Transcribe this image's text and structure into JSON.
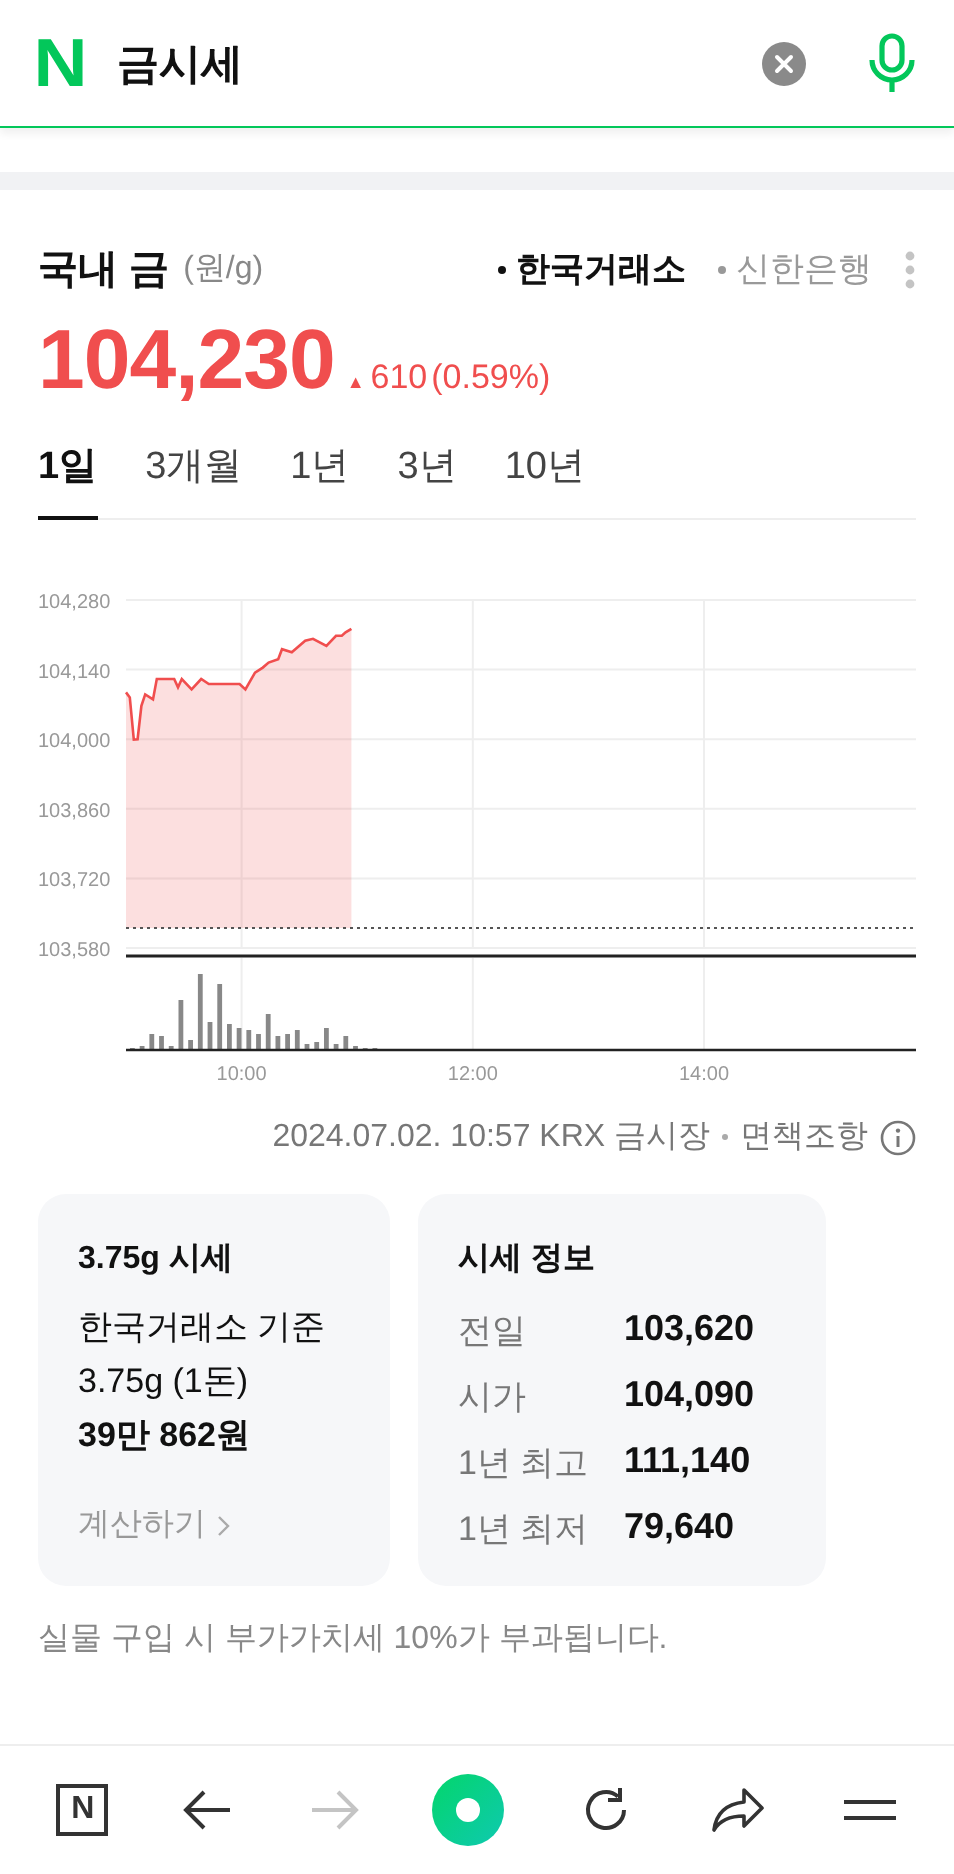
{
  "header": {
    "logo": "N",
    "query": "금시세"
  },
  "quote": {
    "title": "국내 금",
    "unit": "(원/g)",
    "sources": [
      {
        "label": "한국거래소",
        "selected": true
      },
      {
        "label": "신한은행",
        "selected": false
      }
    ],
    "price": "104,230",
    "change_arrow": "▲",
    "change": "610",
    "change_pct": "(0.59%)"
  },
  "tabs": [
    {
      "label": "1일",
      "selected": true
    },
    {
      "label": "3개월",
      "selected": false
    },
    {
      "label": "1년",
      "selected": false
    },
    {
      "label": "3년",
      "selected": false
    },
    {
      "label": "10년",
      "selected": false
    }
  ],
  "chart_data": {
    "type": "area",
    "xlim": [
      540,
      950
    ],
    "ylim": [
      103580,
      104280
    ],
    "yticks": [
      {
        "value": 104280,
        "label": "104,280"
      },
      {
        "value": 104140,
        "label": "104,140"
      },
      {
        "value": 104000,
        "label": "104,000"
      },
      {
        "value": 103860,
        "label": "103,860"
      },
      {
        "value": 103720,
        "label": "103,720"
      },
      {
        "value": 103580,
        "label": "103,580"
      }
    ],
    "xticks": [
      {
        "value": 600,
        "label": "10:00"
      },
      {
        "value": 720,
        "label": "12:00"
      },
      {
        "value": 840,
        "label": "14:00"
      }
    ],
    "x": [
      540,
      542,
      544,
      546,
      548,
      550,
      554,
      556,
      565,
      567,
      569,
      574,
      579,
      583,
      599,
      602,
      607,
      611,
      614,
      619,
      621,
      626,
      633,
      637,
      644,
      649,
      652,
      654,
      657
    ],
    "series": [
      {
        "color": "#f04e4e",
        "values": [
          104094,
          104084,
          103999,
          104000,
          104067,
          104090,
          104080,
          104121,
          104121,
          104104,
          104121,
          104100,
          104121,
          104111,
          104111,
          104100,
          104134,
          104144,
          104154,
          104161,
          104181,
          104175,
          104198,
          104202,
          104188,
          104208,
          104208,
          104215,
          104222
        ]
      }
    ],
    "grid": true,
    "ref_lines": [
      {
        "axis": "y",
        "value": 103620
      }
    ]
  },
  "timestamp": "2024.07.02. 10:57 KRX 금시장",
  "disclaimer": "면책조항",
  "card_left": {
    "title": "3.75g 시세",
    "lines": [
      "한국거래소 기준",
      "3.75g (1돈)"
    ],
    "amount": "39만 862원",
    "link": "계산하기"
  },
  "card_right": {
    "title": "시세 정보",
    "rows": [
      {
        "label": "전일",
        "value": "103,620"
      },
      {
        "label": "시가",
        "value": "104,090"
      },
      {
        "label": "1년 최고",
        "value": "111,140"
      },
      {
        "label": "1년 최저",
        "value": "79,640"
      }
    ]
  },
  "note": "실물 구입 시 부가가치세 10%가 부과됩니다.",
  "nav": [
    {
      "kind": "home",
      "label": "N",
      "disabled": false
    },
    {
      "kind": "back",
      "disabled": false
    },
    {
      "kind": "forward",
      "disabled": true
    },
    {
      "kind": "assistant",
      "disabled": false
    },
    {
      "kind": "reload",
      "disabled": false
    },
    {
      "kind": "share",
      "disabled": false
    },
    {
      "kind": "menu",
      "disabled": false
    }
  ]
}
